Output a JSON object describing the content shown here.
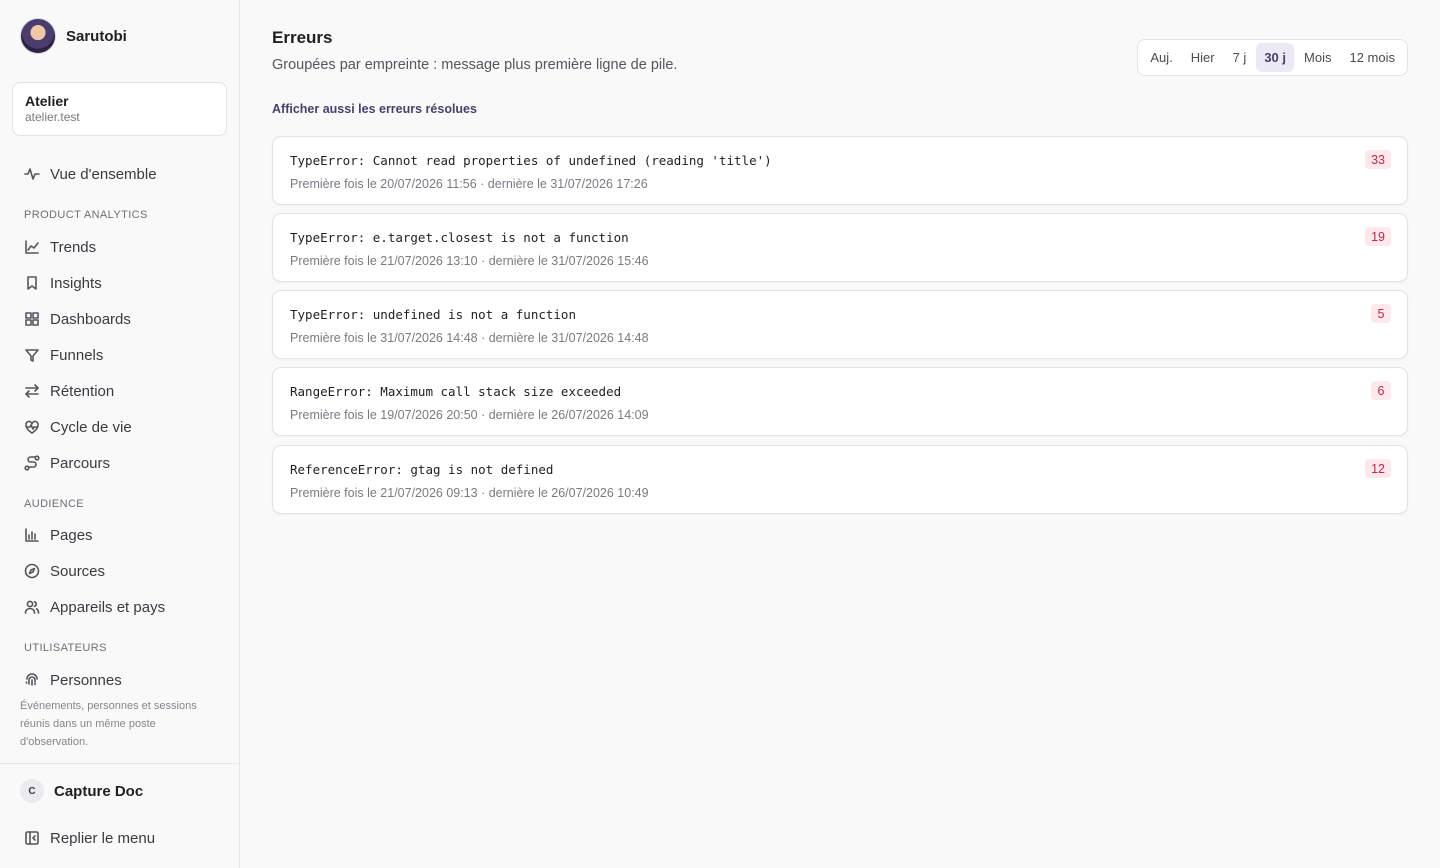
{
  "brand": {
    "name": "Sarutobi"
  },
  "site": {
    "name": "Atelier",
    "domain": "atelier.test"
  },
  "nav": {
    "overview": "Vue d'ensemble",
    "sections": {
      "product": "PRODUCT ANALYTICS",
      "audience": "AUDIENCE",
      "users": "UTILISATEURS"
    },
    "product_items": [
      "Trends",
      "Insights",
      "Dashboards",
      "Funnels",
      "Rétention",
      "Cycle de vie",
      "Parcours"
    ],
    "audience_items": [
      "Pages",
      "Sources",
      "Appareils et pays"
    ],
    "users_items": [
      "Personnes"
    ],
    "note": "Événements, personnes et sessions réunis dans un même poste d'observation."
  },
  "footer": {
    "user_initial": "C",
    "user_name": "Capture Doc",
    "collapse_label": "Replier le menu"
  },
  "page": {
    "title": "Erreurs",
    "subtitle": "Groupées par empreinte : message plus première ligne de pile.",
    "show_resolved": "Afficher aussi les erreurs résolues"
  },
  "ranges": {
    "options": [
      "Auj.",
      "Hier",
      "7 j",
      "30 j",
      "Mois",
      "12 mois"
    ],
    "selected": "30 j"
  },
  "errors": [
    {
      "message": "TypeError: Cannot read properties of undefined (reading 'title')",
      "meta": "Première fois le 20/07/2026 11:56 · dernière le 31/07/2026 17:26",
      "count": "33"
    },
    {
      "message": "TypeError: e.target.closest is not a function",
      "meta": "Première fois le 21/07/2026 13:10 · dernière le 31/07/2026 15:46",
      "count": "19"
    },
    {
      "message": "TypeError: undefined is not a function",
      "meta": "Première fois le 31/07/2026 14:48 · dernière le 31/07/2026 14:48",
      "count": "5"
    },
    {
      "message": "RangeError: Maximum call stack size exceeded",
      "meta": "Première fois le 19/07/2026 20:50 · dernière le 26/07/2026 14:09",
      "count": "6"
    },
    {
      "message": "ReferenceError: gtag is not defined",
      "meta": "Première fois le 21/07/2026 09:13 · dernière le 26/07/2026 10:49",
      "count": "12"
    }
  ],
  "colors": {
    "accent": "#4a3f6b",
    "count_bg": "#fde8ec",
    "count_text": "#c2274a"
  }
}
